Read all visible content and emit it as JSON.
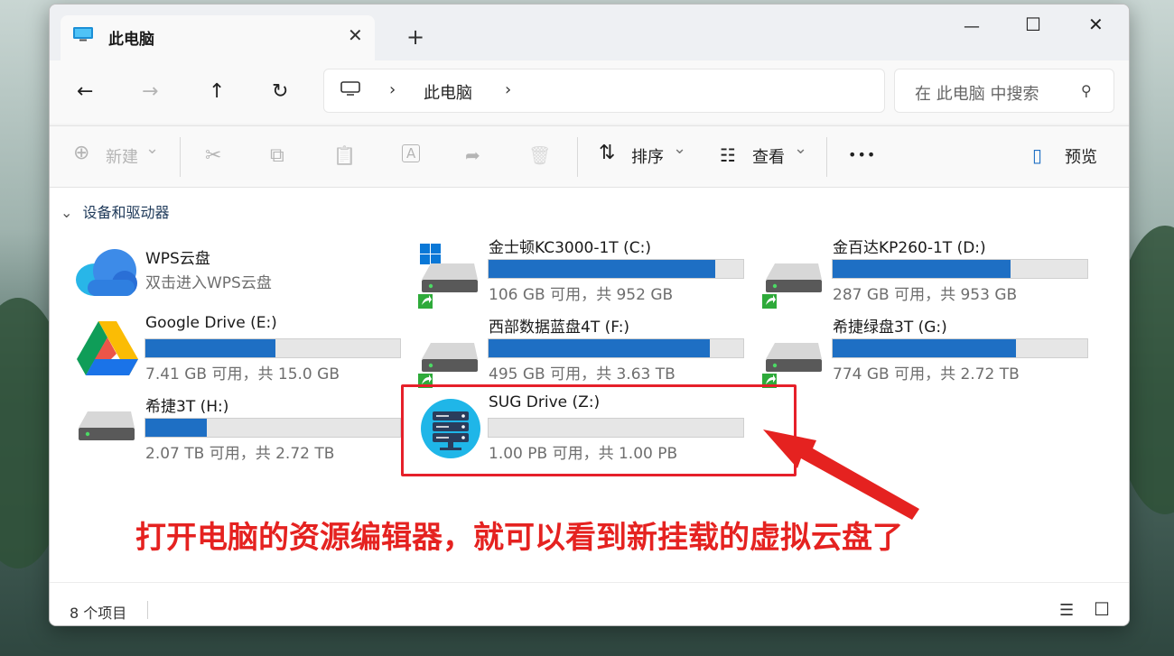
{
  "window": {
    "tab_title": "此电脑",
    "close_tab_glyph": "✕",
    "new_tab_glyph": "+",
    "minimize_glyph": "—",
    "maximize_glyph": "☐",
    "close_glyph": "✕"
  },
  "nav": {
    "back_glyph": "←",
    "forward_glyph": "→",
    "up_glyph": "↑",
    "refresh_glyph": "↻",
    "chevron": "›",
    "breadcrumb": "此电脑",
    "search_placeholder": "在 此电脑 中搜索",
    "search_icon": "⚲"
  },
  "toolbar": {
    "new_icon": "⊕",
    "new_label": "新建",
    "dropdown_glyph": "⌄",
    "cut_icon": "✂",
    "copy_icon": "⧉",
    "paste_icon": "📋",
    "rename_icon": "A",
    "share_icon": "➦",
    "delete_icon": "🗑",
    "sort_icon": "⇅",
    "sort_label": "排序",
    "view_icon": "☷",
    "view_label": "查看",
    "more_glyph": "•••",
    "preview_icon": "▯",
    "preview_label": "预览"
  },
  "section": {
    "collapse_glyph": "⌄",
    "title": "设备和驱动器"
  },
  "drives": [
    {
      "name": "WPS云盘",
      "sub": "双击进入WPS云盘",
      "icon": "cloud-icon",
      "type": "cloud"
    },
    {
      "name": "金士顿KC3000-1T (C:)",
      "size": "106 GB 可用，共 952 GB",
      "used_fraction": 0.89,
      "icon": "windows-drive-icon"
    },
    {
      "name": "金百达KP260-1T (D:)",
      "size": "287 GB 可用，共 953 GB",
      "used_fraction": 0.7,
      "icon": "hard-drive-icon"
    },
    {
      "name": "Google Drive (E:)",
      "size": "7.41 GB 可用，共 15.0 GB",
      "used_fraction": 0.51,
      "icon": "google-drive-icon"
    },
    {
      "name": "西部数据蓝盘4T (F:)",
      "size": "495 GB 可用，共 3.63 TB",
      "used_fraction": 0.87,
      "icon": "hard-drive-icon"
    },
    {
      "name": "希捷绿盘3T (G:)",
      "size": "774 GB 可用，共 2.72 TB",
      "used_fraction": 0.72,
      "icon": "hard-drive-icon"
    },
    {
      "name": "希捷3T (H:)",
      "size": "2.07 TB 可用，共 2.72 TB",
      "used_fraction": 0.24,
      "icon": "hard-drive-icon"
    },
    {
      "name": "SUG Drive (Z:)",
      "size": "1.00 PB 可用，共 1.00 PB",
      "used_fraction": 0.0,
      "icon": "server-icon"
    }
  ],
  "caption": "打开电脑的资源编辑器，就可以看到新挂载的虚拟云盘了",
  "status": {
    "item_count": "8 个项目",
    "details_view_glyph": "☰",
    "tiles_view_glyph": "☐"
  },
  "colors": {
    "accent_bar": "#1e6fc4",
    "highlight_red": "#e6202a"
  }
}
